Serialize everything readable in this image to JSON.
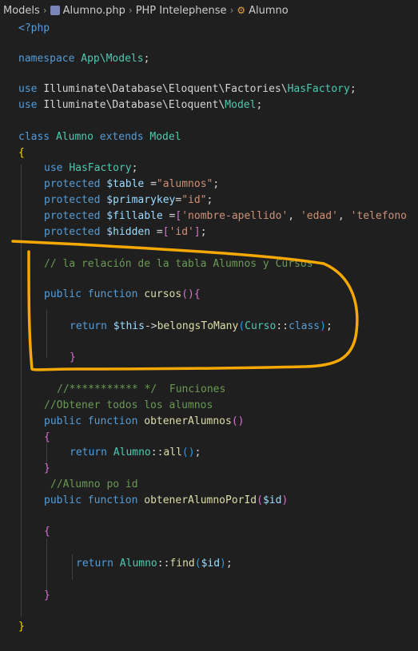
{
  "breadcrumb": {
    "folder": "Models",
    "file": "Alumno.php",
    "section": "PHP Intelephense",
    "symbol": "Alumno"
  },
  "code": {
    "l1": "<?php",
    "l3a": "namespace ",
    "l3b": "App\\Models",
    "l3c": ";",
    "l5a": "use ",
    "l5b": "Illuminate\\Database\\Eloquent\\Factories\\",
    "l5c": "HasFactory",
    "l5d": ";",
    "l6a": "use ",
    "l6b": "Illuminate\\Database\\Eloquent\\",
    "l6c": "Model",
    "l6d": ";",
    "l8a": "class ",
    "l8b": "Alumno ",
    "l8c": "extends ",
    "l8d": "Model",
    "l9": "{",
    "l10a": "use ",
    "l10b": "HasFactory",
    "l10c": ";",
    "l11a": "protected ",
    "l11b": "$table",
    "l11c": " =",
    "l11d": "\"alumnos\"",
    "l11e": ";",
    "l12a": "protected ",
    "l12b": "$primarykey",
    "l12c": "=",
    "l12d": "\"id\"",
    "l12e": ";",
    "l13a": "protected ",
    "l13b": "$fillable",
    "l13c": " =",
    "l13d": "[",
    "l13e": "'nombre-apellido'",
    "l13f": ", ",
    "l13g": "'edad'",
    "l13h": ", ",
    "l13i": "'telefono",
    "l14a": "protected ",
    "l14b": "$hidden",
    "l14c": " =",
    "l14d": "[",
    "l14e": "'id'",
    "l14f": "]",
    "l14g": ";",
    "l16": "// la relación de la tabla Alumnos y Cursos",
    "l18a": "public ",
    "l18b": "function ",
    "l18c": "cursos",
    "l18d": "()",
    "l18e": "{",
    "l20a": "return ",
    "l20b": "$this",
    "l20c": "->",
    "l20d": "belongsToMany",
    "l20e": "(",
    "l20f": "Curso",
    "l20g": "::",
    "l20h": "class",
    "l20i": ")",
    "l20j": ";",
    "l22": "}",
    "l24": "//*********** */  Funciones",
    "l25": "//Obtener todos los alumnos",
    "l26a": "public ",
    "l26b": "function ",
    "l26c": "obtenerAlumnos",
    "l26d": "()",
    "l27": "{",
    "l28a": "return ",
    "l28b": "Alumno",
    "l28c": "::",
    "l28d": "all",
    "l28e": "()",
    "l28f": ";",
    "l29": "}",
    "l30": "//Alumno po id",
    "l31a": "public ",
    "l31b": "function ",
    "l31c": "obtenerAlumnoPorId",
    "l31d": "(",
    "l31e": "$id",
    "l31f": ")",
    "l33": "{",
    "l35a": "return ",
    "l35b": "Alumno",
    "l35c": "::",
    "l35d": "find",
    "l35e": "(",
    "l35f": "$id",
    "l35g": ")",
    "l35h": ";",
    "l37": "}",
    "l39": "}"
  },
  "colors": {
    "highlight": "#f5a800",
    "background": "#1f1f1f"
  }
}
